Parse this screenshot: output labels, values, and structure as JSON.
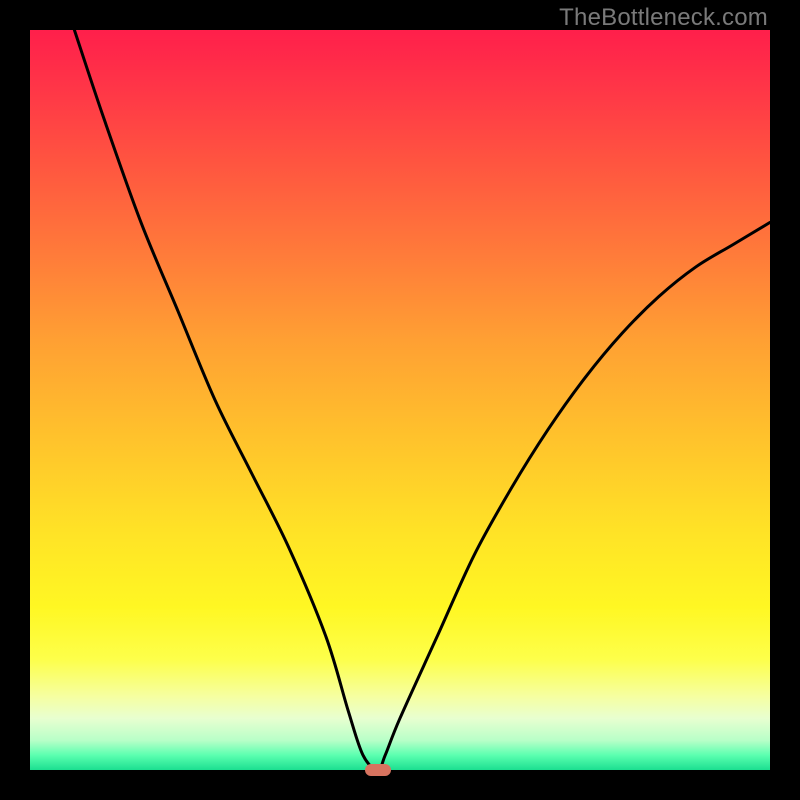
{
  "watermark": "TheBottleneck.com",
  "chart_data": {
    "type": "line",
    "title": "",
    "xlabel": "",
    "ylabel": "",
    "xlim": [
      0,
      100
    ],
    "ylim": [
      0,
      100
    ],
    "grid": false,
    "legend": false,
    "series": [
      {
        "name": "curve",
        "x": [
          6,
          10,
          15,
          20,
          25,
          30,
          35,
          40,
          43,
          45,
          47,
          48,
          50,
          55,
          60,
          65,
          70,
          75,
          80,
          85,
          90,
          95,
          100
        ],
        "y": [
          100,
          88,
          74,
          62,
          50,
          40,
          30,
          18,
          8,
          2,
          0,
          2,
          7,
          18,
          29,
          38,
          46,
          53,
          59,
          64,
          68,
          71,
          74
        ]
      }
    ],
    "marker": {
      "x": 47,
      "y": 0
    },
    "background_gradient": {
      "top": "#ff1f4b",
      "mid": "#ffe326",
      "bottom": "#1cdf90"
    }
  }
}
